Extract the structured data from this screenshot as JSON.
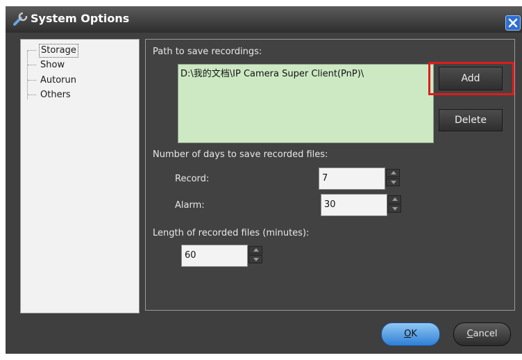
{
  "window": {
    "title": "System Options",
    "icon": "wrench-icon",
    "close_icon": "close-icon"
  },
  "nav": {
    "items": [
      {
        "label": "Storage",
        "selected": true
      },
      {
        "label": "Show",
        "selected": false
      },
      {
        "label": "Autorun",
        "selected": false
      },
      {
        "label": "Others",
        "selected": false
      }
    ]
  },
  "storage": {
    "path_label": "Path to save recordings:",
    "path_value": "D:\\我的文档\\IP Camera Super Client(PnP)\\",
    "add_label": "Add",
    "delete_label": "Delete",
    "days_label": "Number of days to save recorded files:",
    "record_label": "Record:",
    "record_value": "7",
    "alarm_label": "Alarm:",
    "alarm_value": "30",
    "length_label": "Length of recorded files (minutes):",
    "length_value": "60"
  },
  "footer": {
    "ok_mnemonic": "O",
    "ok_rest": "K",
    "cancel_mnemonic": "C",
    "cancel_rest": "ancel"
  },
  "colors": {
    "path_box": "#cde9c4",
    "highlight": "#dd1c1c",
    "ok_button": "#2e7fd6",
    "dialog_bg": "#3f3f3f"
  }
}
